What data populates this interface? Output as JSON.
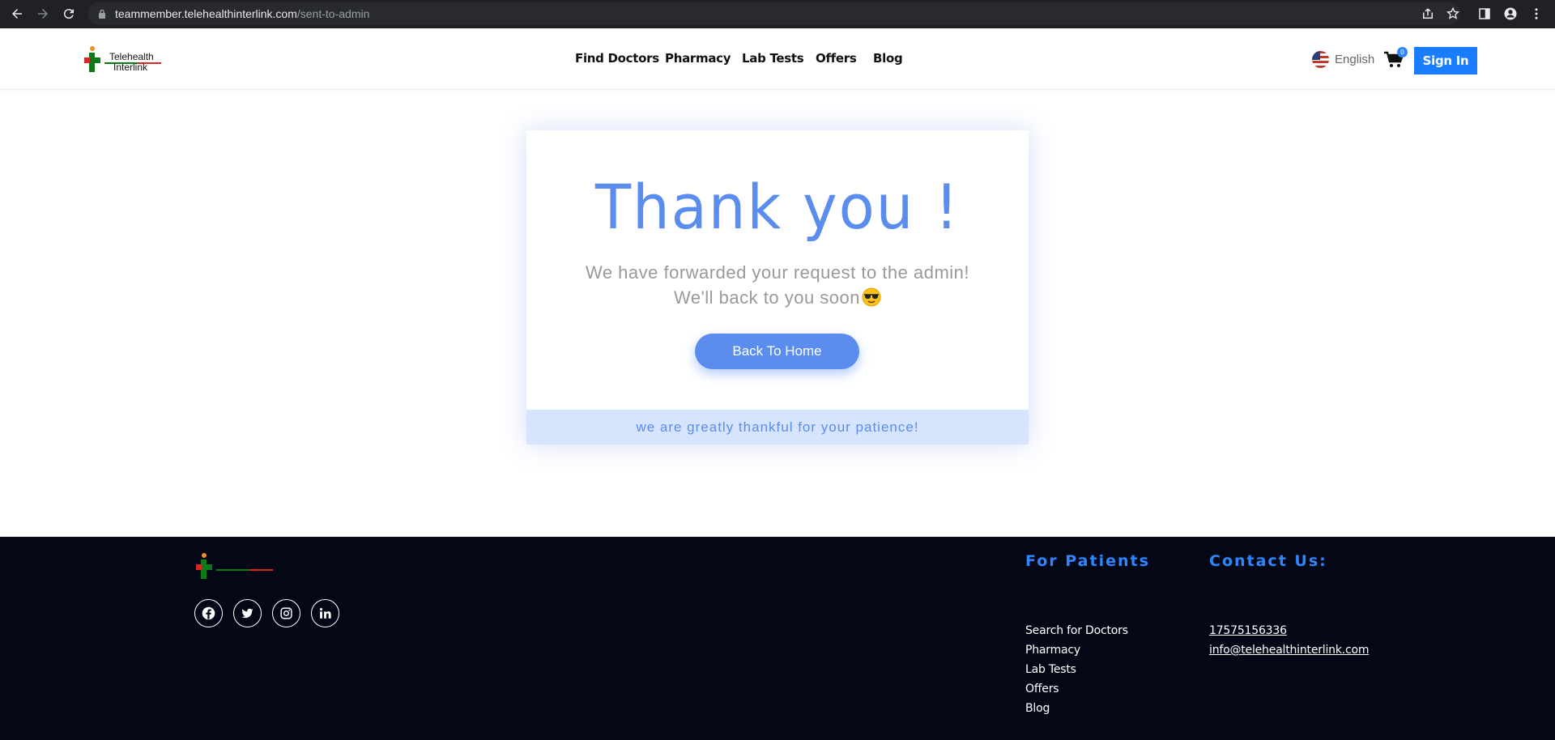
{
  "browser": {
    "url_host": "teammember.telehealthinterlink.com",
    "url_path": "/sent-to-admin"
  },
  "header": {
    "logo_line1": "Telehealth",
    "logo_line2": "Interlink",
    "nav": [
      "Find Doctors",
      "Pharmacy",
      "Lab Tests",
      "Offers",
      "Blog"
    ],
    "language": "English",
    "cart_count": "0",
    "signin_label": "Sign In"
  },
  "card": {
    "title": "Thank you !",
    "message_line1": "We have forwarded your request to the admin!",
    "message_line2": "We'll back to you soon",
    "button_label": "Back To Home",
    "footer_text": "we are greatly thankful for your patience!"
  },
  "footer": {
    "patients_heading": "For Patients",
    "patients_links": [
      "Search for Doctors",
      "Pharmacy",
      "Lab Tests",
      "Offers",
      "Blog"
    ],
    "contact_heading": "Contact Us:",
    "phone": "17575156336",
    "email": "info@telehealthinterlink.com",
    "socials": [
      "facebook-icon",
      "twitter-icon",
      "instagram-icon",
      "linkedin-icon"
    ]
  },
  "colors": {
    "accent": "#5b8dee",
    "brand_blue": "#1a7dff",
    "footer_bg": "#040816",
    "card_footer_bg": "#d6e4fd"
  }
}
